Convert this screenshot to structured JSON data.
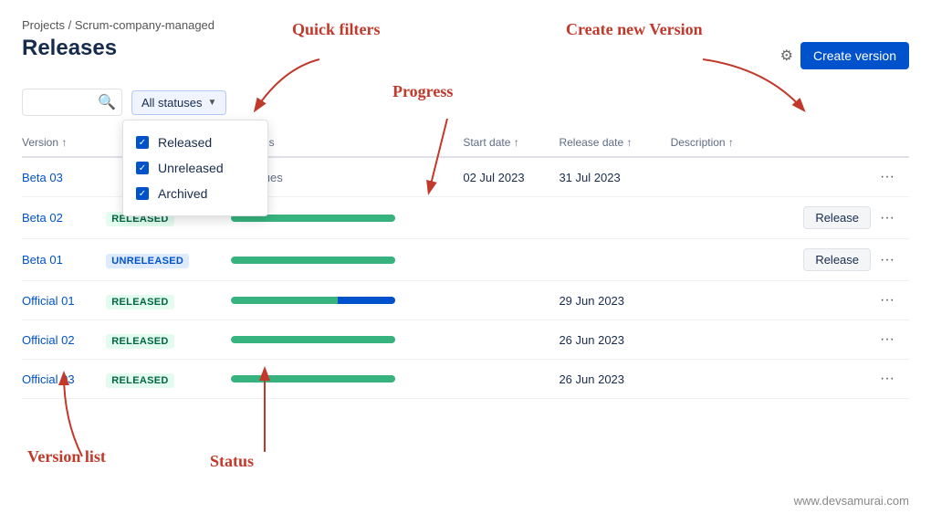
{
  "breadcrumb": {
    "projects_label": "Projects",
    "separator": "/",
    "project_name": "Scrum-company-managed"
  },
  "page": {
    "title": "Releases"
  },
  "toolbar": {
    "search_placeholder": "",
    "filter_label": "All statuses",
    "create_version_label": "Create version"
  },
  "filter_menu": {
    "items": [
      {
        "label": "Released",
        "checked": true
      },
      {
        "label": "Unreleased",
        "checked": true
      },
      {
        "label": "Archived",
        "checked": true
      }
    ]
  },
  "table": {
    "headers": [
      {
        "label": "Version ↑"
      },
      {
        "label": ""
      },
      {
        "label": "Progress"
      },
      {
        "label": "Start date ↑"
      },
      {
        "label": "Release date ↑"
      },
      {
        "label": "Description ↑"
      },
      {
        "label": ""
      }
    ],
    "rows": [
      {
        "version": "Beta 03",
        "status": "",
        "status_class": "",
        "progress_type": "no_issues",
        "progress_green": 0,
        "progress_blue": 0,
        "start_date": "02 Jul 2023",
        "release_date": "31 Jul 2023",
        "description": "",
        "actions": [
          "more"
        ]
      },
      {
        "version": "Beta 02",
        "status": "RELEASED",
        "status_class": "status-released",
        "progress_type": "bar",
        "progress_green": 100,
        "progress_blue": 0,
        "start_date": "",
        "release_date": "",
        "description": "",
        "actions": [
          "release",
          "more"
        ]
      },
      {
        "version": "Beta 01",
        "status": "UNRELEASED",
        "status_class": "status-unreleased",
        "progress_type": "bar",
        "progress_green": 100,
        "progress_blue": 0,
        "start_date": "",
        "release_date": "",
        "description": "",
        "actions": [
          "release",
          "more"
        ]
      },
      {
        "version": "Official 01",
        "status": "RELEASED",
        "status_class": "status-released",
        "progress_type": "bar_mixed",
        "progress_green": 65,
        "progress_blue": 35,
        "start_date": "",
        "release_date": "29 Jun 2023",
        "description": "",
        "actions": [
          "more"
        ]
      },
      {
        "version": "Official 02",
        "status": "RELEASED",
        "status_class": "status-released",
        "progress_type": "bar",
        "progress_green": 100,
        "progress_blue": 0,
        "start_date": "",
        "release_date": "26 Jun 2023",
        "description": "",
        "actions": [
          "more"
        ]
      },
      {
        "version": "Official 03",
        "status": "RELEASED",
        "status_class": "status-released",
        "progress_type": "bar",
        "progress_green": 100,
        "progress_blue": 0,
        "start_date": "",
        "release_date": "26 Jun 2023",
        "description": "",
        "actions": [
          "more"
        ]
      }
    ]
  },
  "annotations": {
    "quick_filters": "Quick filters",
    "progress": "Progress",
    "create_new_version": "Create new Version",
    "version_list": "Version list",
    "status": "Status"
  },
  "watermark": "www.devsamurai.com",
  "action_labels": {
    "release": "Release",
    "more": "···"
  }
}
